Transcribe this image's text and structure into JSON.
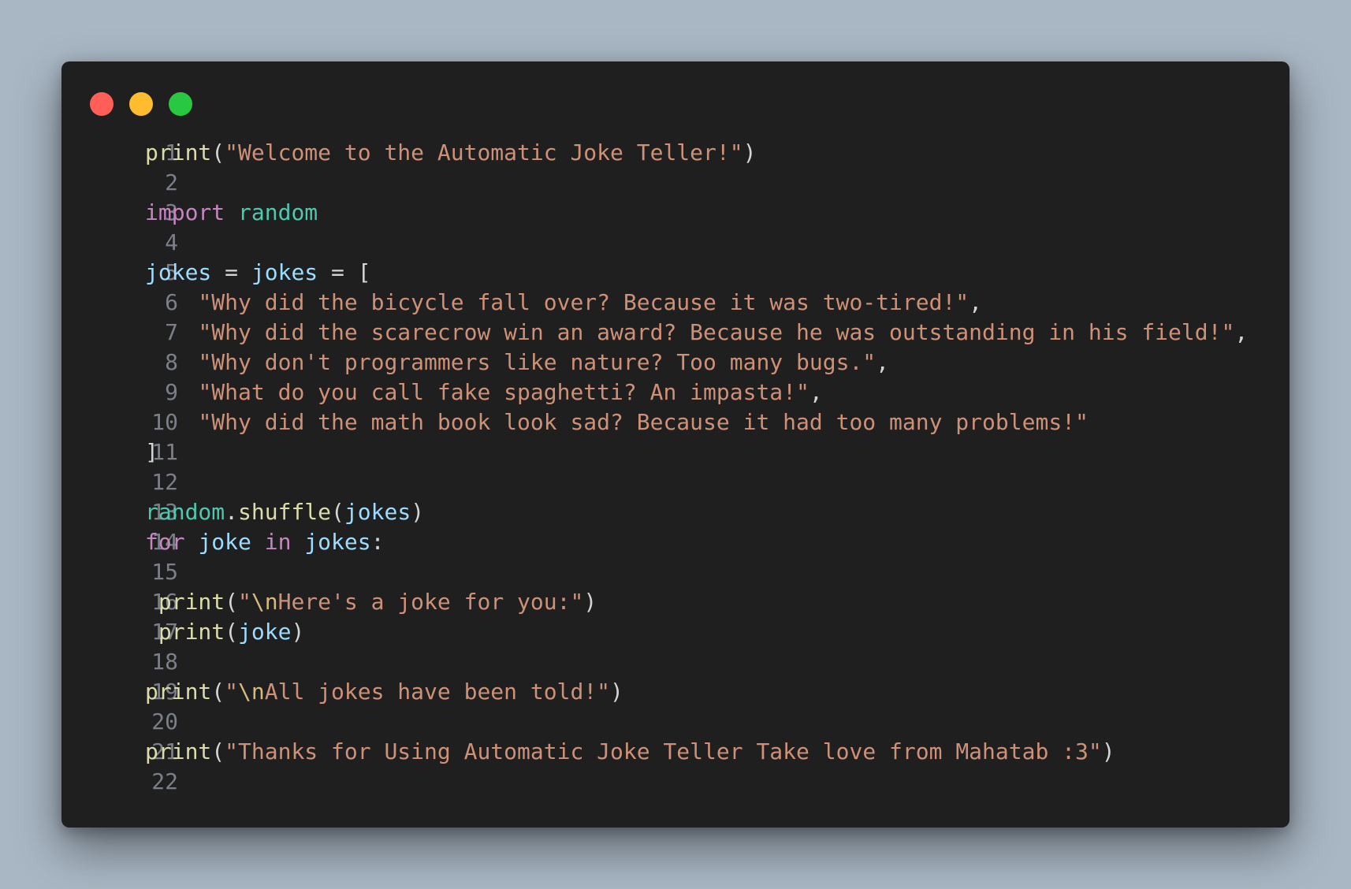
{
  "window": {
    "controls": [
      {
        "name": "close",
        "color": "#ff5f57"
      },
      {
        "name": "minimize",
        "color": "#febc2e"
      },
      {
        "name": "maximize",
        "color": "#28c840"
      }
    ]
  },
  "code": {
    "language": "python",
    "lines": [
      {
        "n": "1",
        "tokens": [
          {
            "t": "fn",
            "v": "print"
          },
          {
            "t": "pun",
            "v": "("
          },
          {
            "t": "str",
            "v": "\"Welcome to the Automatic Joke Teller!\""
          },
          {
            "t": "pun",
            "v": ")"
          }
        ]
      },
      {
        "n": "2",
        "tokens": []
      },
      {
        "n": "3",
        "tokens": [
          {
            "t": "kw",
            "v": "import"
          },
          {
            "t": "pun",
            "v": " "
          },
          {
            "t": "mod",
            "v": "random"
          }
        ]
      },
      {
        "n": "4",
        "tokens": []
      },
      {
        "n": "5",
        "tokens": [
          {
            "t": "var",
            "v": "jokes"
          },
          {
            "t": "pun",
            "v": " = "
          },
          {
            "t": "var",
            "v": "jokes"
          },
          {
            "t": "pun",
            "v": " = ["
          }
        ]
      },
      {
        "n": "6",
        "tokens": [
          {
            "t": "pun",
            "v": "    "
          },
          {
            "t": "str",
            "v": "\"Why did the bicycle fall over? Because it was two-tired!\""
          },
          {
            "t": "pun",
            "v": ","
          }
        ]
      },
      {
        "n": "7",
        "tokens": [
          {
            "t": "pun",
            "v": "    "
          },
          {
            "t": "str",
            "v": "\"Why did the scarecrow win an award? Because he was outstanding in his field!\""
          },
          {
            "t": "pun",
            "v": ","
          }
        ]
      },
      {
        "n": "8",
        "tokens": [
          {
            "t": "pun",
            "v": "    "
          },
          {
            "t": "str",
            "v": "\"Why don't programmers like nature? Too many bugs.\""
          },
          {
            "t": "pun",
            "v": ","
          }
        ]
      },
      {
        "n": "9",
        "tokens": [
          {
            "t": "pun",
            "v": "    "
          },
          {
            "t": "str",
            "v": "\"What do you call fake spaghetti? An impasta!\""
          },
          {
            "t": "pun",
            "v": ","
          }
        ]
      },
      {
        "n": "10",
        "tokens": [
          {
            "t": "pun",
            "v": "    "
          },
          {
            "t": "str",
            "v": "\"Why did the math book look sad? Because it had too many problems!\""
          }
        ]
      },
      {
        "n": "11",
        "tokens": [
          {
            "t": "pun",
            "v": "]"
          }
        ]
      },
      {
        "n": "12",
        "tokens": []
      },
      {
        "n": "13",
        "tokens": [
          {
            "t": "mod",
            "v": "random"
          },
          {
            "t": "pun",
            "v": "."
          },
          {
            "t": "fn",
            "v": "shuffle"
          },
          {
            "t": "pun",
            "v": "("
          },
          {
            "t": "var",
            "v": "jokes"
          },
          {
            "t": "pun",
            "v": ")"
          }
        ]
      },
      {
        "n": "14",
        "tokens": [
          {
            "t": "kw",
            "v": "for"
          },
          {
            "t": "pun",
            "v": " "
          },
          {
            "t": "var",
            "v": "joke"
          },
          {
            "t": "pun",
            "v": " "
          },
          {
            "t": "kw",
            "v": "in"
          },
          {
            "t": "pun",
            "v": " "
          },
          {
            "t": "var",
            "v": "jokes"
          },
          {
            "t": "pun",
            "v": ":"
          }
        ]
      },
      {
        "n": "15",
        "tokens": []
      },
      {
        "n": "16",
        "tokens": [
          {
            "t": "pun",
            "v": " "
          },
          {
            "t": "fn",
            "v": "print"
          },
          {
            "t": "pun",
            "v": "("
          },
          {
            "t": "str",
            "v": "\""
          },
          {
            "t": "esc",
            "v": "\\n"
          },
          {
            "t": "str",
            "v": "Here's a joke for you:\""
          },
          {
            "t": "pun",
            "v": ")"
          }
        ]
      },
      {
        "n": "17",
        "tokens": [
          {
            "t": "pun",
            "v": " "
          },
          {
            "t": "fn",
            "v": "print"
          },
          {
            "t": "pun",
            "v": "("
          },
          {
            "t": "var",
            "v": "joke"
          },
          {
            "t": "pun",
            "v": ")"
          }
        ]
      },
      {
        "n": "18",
        "tokens": []
      },
      {
        "n": "19",
        "tokens": [
          {
            "t": "fn",
            "v": "print"
          },
          {
            "t": "pun",
            "v": "("
          },
          {
            "t": "str",
            "v": "\""
          },
          {
            "t": "esc",
            "v": "\\n"
          },
          {
            "t": "str",
            "v": "All jokes have been told!\""
          },
          {
            "t": "pun",
            "v": ")"
          }
        ]
      },
      {
        "n": "20",
        "tokens": []
      },
      {
        "n": "21",
        "tokens": [
          {
            "t": "fn",
            "v": "print"
          },
          {
            "t": "pun",
            "v": "("
          },
          {
            "t": "str",
            "v": "\"Thanks for Using Automatic Joke Teller Take love from Mahatab :3\""
          },
          {
            "t": "pun",
            "v": ")"
          }
        ]
      },
      {
        "n": "22",
        "tokens": []
      }
    ]
  }
}
